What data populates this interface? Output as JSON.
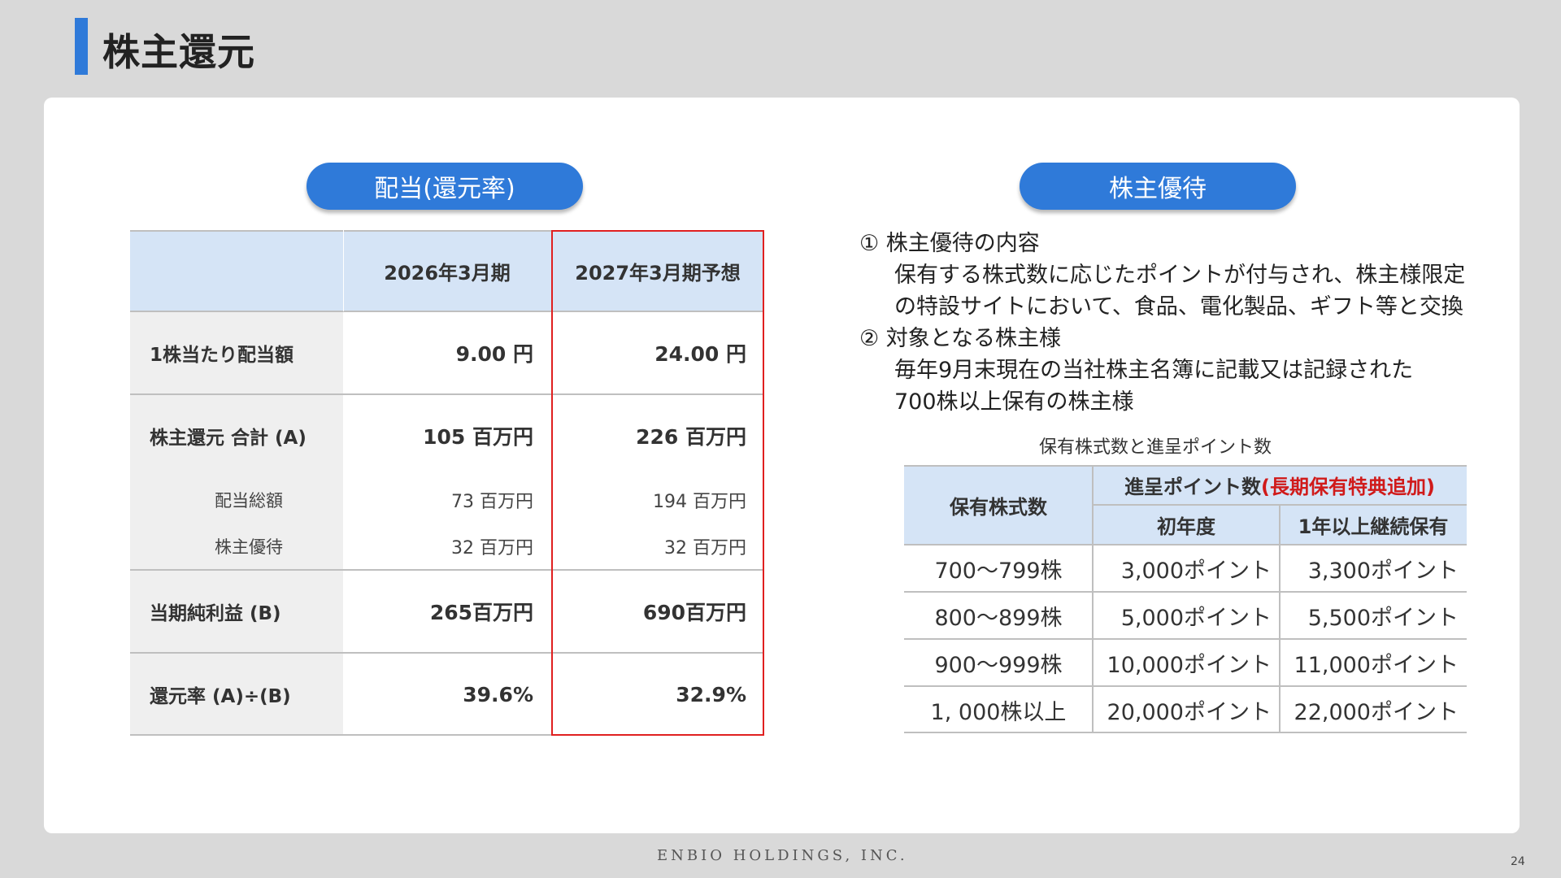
{
  "page_title": "株主還元",
  "dividend": {
    "pill": "配当(還元率)",
    "columns": [
      "2026年3月期",
      "2027年3月期予想"
    ],
    "rows": [
      {
        "label": "1株当たり配当額",
        "v2026": "9.00 円",
        "v2027": "24.00 円"
      },
      {
        "label": "株主還元 合計 (A)",
        "v2026": "105 百万円",
        "v2027": "226 百万円"
      },
      {
        "label": "配当総額",
        "v2026": "73 百万円",
        "v2027": "194 百万円"
      },
      {
        "label": "株主優待",
        "v2026": "32 百万円",
        "v2027": "32 百万円"
      },
      {
        "label": "当期純利益 (B)",
        "v2026": "265百万円",
        "v2027": "690百万円"
      },
      {
        "label": "還元率 (A)÷(B)",
        "v2026": "39.6%",
        "v2027": "32.9%"
      }
    ]
  },
  "benefit": {
    "pill": "株主優待",
    "item1_title": "① 株主優待の内容",
    "item1_line1": "保有する株式数に応じたポイントが付与され、株主様限定",
    "item1_line2": "の特設サイトにおいて、食品、電化製品、ギフト等と交換",
    "item2_title": "② 対象となる株主様",
    "item2_line1": "毎年9月末現在の当社株主名簿に記載又は記録された",
    "item2_line2": "700株以上保有の株主様",
    "table_caption": "保有株式数と進呈ポイント数",
    "table": {
      "col_shares": "保有株式数",
      "col_points": "進呈ポイント数",
      "col_points_note": "(長期保有特典追加)",
      "col_first": "初年度",
      "col_continued": "1年以上継続保有",
      "rows": [
        {
          "shares": "700～799株",
          "first": "3,000ポイント",
          "continued": "3,300ポイント"
        },
        {
          "shares": "800～899株",
          "first": "5,000ポイント",
          "continued": "5,500ポイント"
        },
        {
          "shares": "900～999株",
          "first": "10,000ポイント",
          "continued": "11,000ポイント"
        },
        {
          "shares": "1, 000株以上",
          "first": "20,000ポイント",
          "continued": "22,000ポイント"
        }
      ]
    }
  },
  "footer": {
    "company": "ENBIO HOLDINGS, INC.",
    "page_number": "24"
  },
  "colors": {
    "accent": "#2f7ad9",
    "header_fill": "#d5e4f6",
    "highlight_border": "#e02020",
    "note_red": "#d01a1a"
  }
}
